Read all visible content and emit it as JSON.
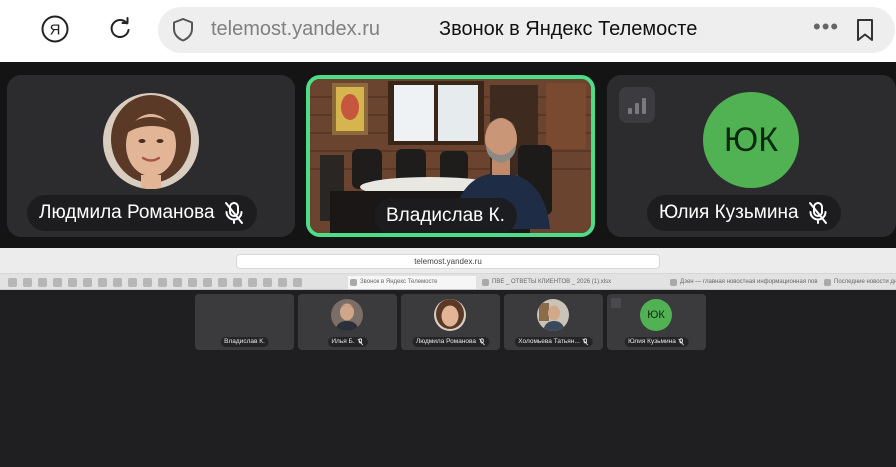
{
  "browser": {
    "logo": "Я",
    "domain": "telemost.yandex.ru",
    "page_title": "Звонок в Яндекс Телемосте",
    "more_label": "•••"
  },
  "participants": [
    {
      "name": "Людмила Романова",
      "mic_muted": true,
      "avatar": "photo-woman"
    },
    {
      "name": "Владислав К.",
      "mic_muted": false,
      "avatar": "video",
      "speaking": true
    },
    {
      "name": "Юлия Кузьмина",
      "mic_muted": true,
      "avatar": "initials",
      "initials": "ЮК"
    }
  ],
  "shared_screen": {
    "url": "telemost.yandex.ru",
    "tabs": [
      "Звонок в Яндекс Телемосте",
      "ПВЕ _ ОТВЕТЫ КЛИЕНТОВ _ 2026 (1).xlsx",
      "Дзен — главная новостная информационная пов...",
      "Последние новости дн"
    ],
    "mini_tiles": [
      {
        "name": "Владислав К.",
        "muted": false
      },
      {
        "name": "Илья Б.",
        "muted": true
      },
      {
        "name": "Людмила Романова",
        "muted": true
      },
      {
        "name": "Холомьева Татьян...",
        "muted": true
      },
      {
        "name": "Юлия Кузьмина",
        "muted": true,
        "initials": "ЮК"
      }
    ]
  },
  "colors": {
    "active_border": "#4cdc8a",
    "initials_avatar": "#51b253"
  }
}
